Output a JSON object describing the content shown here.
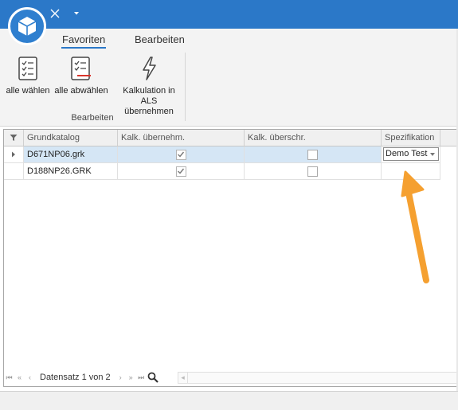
{
  "titlebar": {
    "logo_icon": "cube-icon",
    "close_icon": "close-icon",
    "dropdown_icon": "chevron-down-icon",
    "color": "#2b78c8"
  },
  "ribbon": {
    "tabs": [
      {
        "label": "Favoriten",
        "active": true
      },
      {
        "label": "Bearbeiten",
        "active": false
      }
    ],
    "buttons": [
      {
        "label": "alle wählen",
        "icon": "checklist-icon"
      },
      {
        "label": "alle abwählen",
        "icon": "checklist-clear-icon"
      },
      {
        "label": "Kalkulation in\nALS übernehmen",
        "icon": "lightning-icon"
      }
    ],
    "group_label": "Bearbeiten"
  },
  "grid": {
    "columns": [
      "Grundkatalog",
      "Kalk. übernehm.",
      "Kalk. überschr.",
      "Spezifikation"
    ],
    "filter_icon": "filter-icon",
    "rows": [
      {
        "katalog": "D671NP06.grk",
        "kalk_uebernehm": true,
        "kalk_ueberschr": false,
        "spezifikation": "Demo Test",
        "selected": true
      },
      {
        "katalog": "D188NP26.GRK",
        "kalk_uebernehm": true,
        "kalk_ueberschr": false,
        "spezifikation": "",
        "selected": false
      }
    ]
  },
  "navigator": {
    "record_text": "Datensatz 1 von 2",
    "search_icon": "search-icon"
  },
  "annotation": {
    "arrow_color": "#f5a030"
  }
}
